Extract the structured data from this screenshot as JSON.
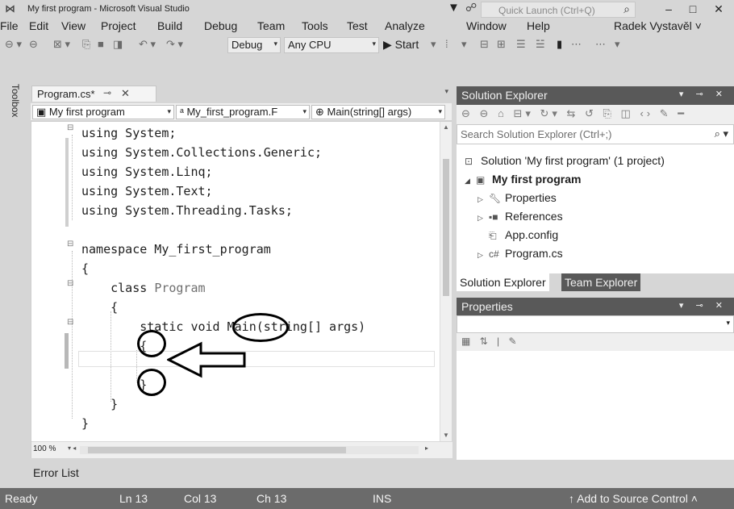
{
  "window": {
    "title": "My first program - Microsoft Visual Studio",
    "quick_launch_placeholder": "Quick Launch (Ctrl+Q)",
    "minimize": "–",
    "maximize": "□",
    "close": "✕"
  },
  "menu": {
    "items": [
      "File",
      "Edit",
      "View",
      "Project",
      "Build",
      "Debug",
      "Team",
      "Tools",
      "Test",
      "Analyze",
      "Window",
      "Help"
    ],
    "account": "Radek Vystavěl ˅"
  },
  "toolbar": {
    "configuration": "Debug",
    "platform": "Any CPU",
    "start_label": "▶ Start"
  },
  "toolbox": {
    "label": "Toolbox"
  },
  "editor": {
    "tab_label": "Program.cs*",
    "nav_project": "My first program",
    "nav_class": "My_first_program.F",
    "nav_member": "Main(string[] args)",
    "zoom": "100 %",
    "code": [
      "using System;",
      "using System.Collections.Generic;",
      "using System.Linq;",
      "using System.Text;",
      "using System.Threading.Tasks;",
      "",
      "namespace My_first_program",
      "{",
      "    class Program",
      "    {",
      "        static void Main(string[] args)",
      "        {",
      "",
      "        }",
      "    }",
      "}"
    ]
  },
  "solution_explorer": {
    "header": "Solution Explorer",
    "search_placeholder": "Search Solution Explorer (Ctrl+;)",
    "tree": [
      {
        "label": "Solution 'My first program' (1 project)"
      },
      {
        "label": "My first program"
      },
      {
        "label": "Properties"
      },
      {
        "label": "References"
      },
      {
        "label": "App.config"
      },
      {
        "label": "Program.cs"
      }
    ],
    "tab_active": "Solution Explorer",
    "tab_inactive": "Team Explorer"
  },
  "properties": {
    "header": "Properties"
  },
  "error_list": {
    "label": "Error List"
  },
  "status": {
    "ready": "Ready",
    "ln": "Ln 13",
    "col": "Col 13",
    "ch": "Ch 13",
    "ins": "INS",
    "source_control": "↑ Add to Source Control ˄"
  },
  "colors": {
    "keyword": "#1e1e1e",
    "type_name": "#6f6f6f",
    "panel_header": "#595959",
    "status_bar": "#6b6b6b"
  }
}
